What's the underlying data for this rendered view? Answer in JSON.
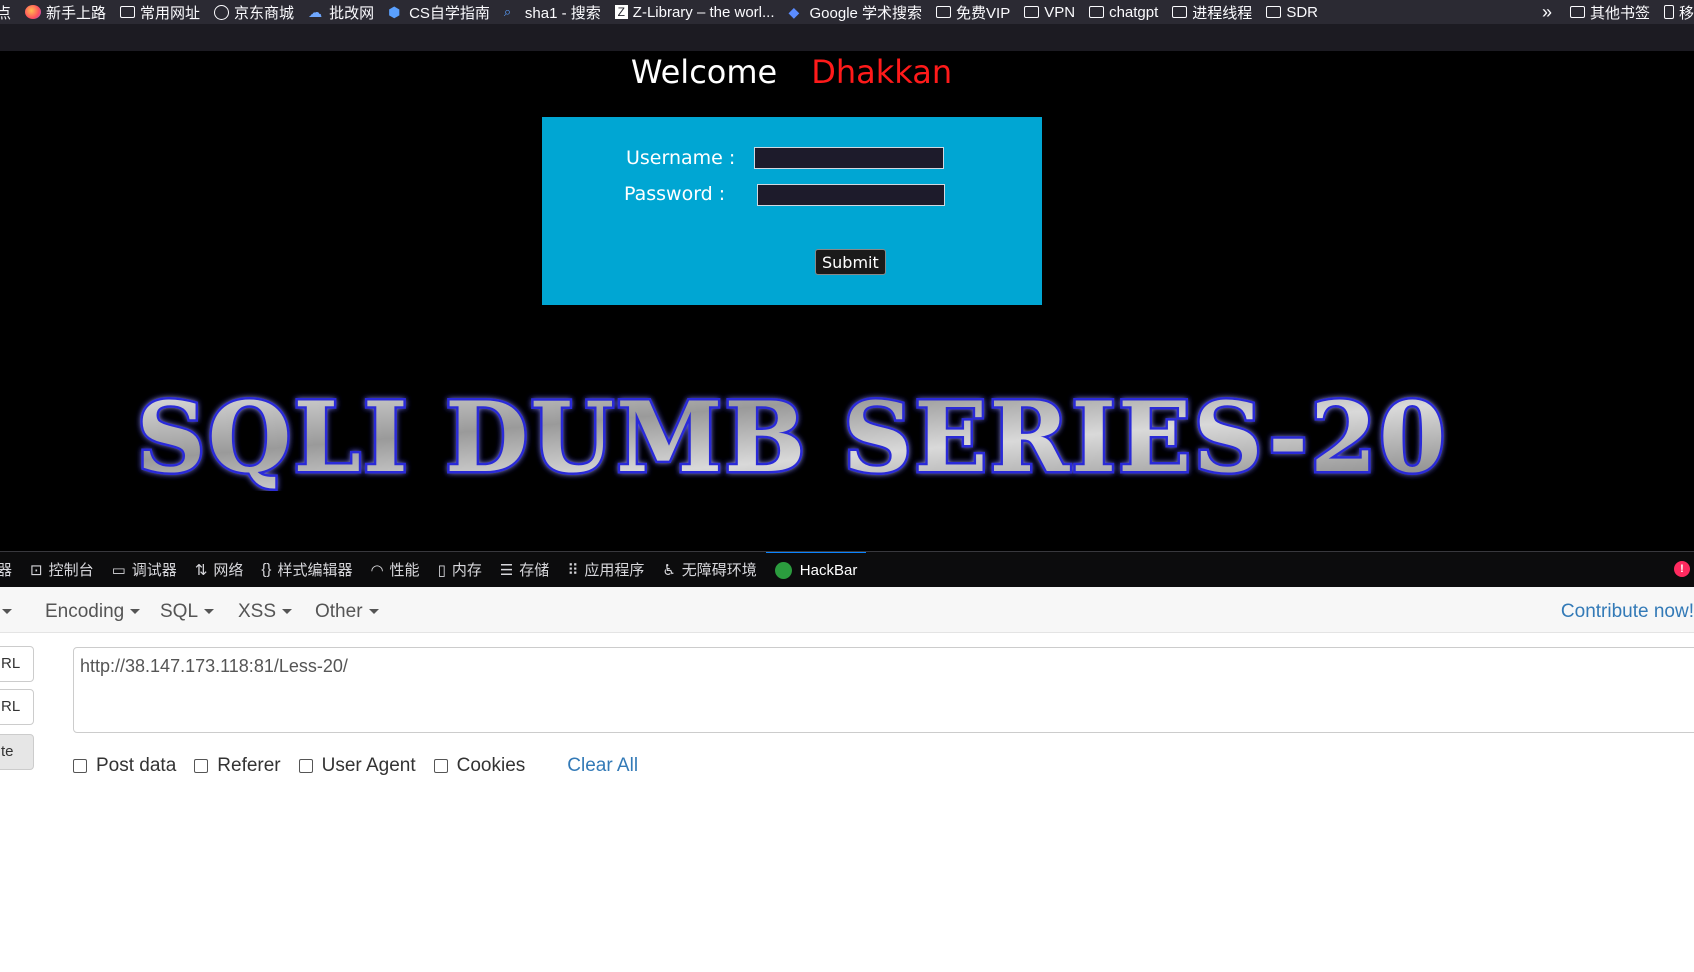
{
  "bookmarks": [
    {
      "label": "点",
      "icon": "bookmark-icon"
    },
    {
      "label": "新手上路",
      "icon": "firefox-icon"
    },
    {
      "label": "常用网址",
      "icon": "folder-icon"
    },
    {
      "label": "京东商城",
      "icon": "globe-icon"
    },
    {
      "label": "批改网",
      "icon": "cloud-icon"
    },
    {
      "label": "CS自学指南",
      "icon": "cube-icon"
    },
    {
      "label": "sha1 - 搜索",
      "icon": "search-icon"
    },
    {
      "label": "Z-Library – the worl...",
      "icon": "zlibrary-icon"
    },
    {
      "label": "Google 学术搜索",
      "icon": "google-scholar-icon"
    },
    {
      "label": "免费VIP",
      "icon": "folder-icon"
    },
    {
      "label": "VPN",
      "icon": "folder-icon"
    },
    {
      "label": "chatgpt",
      "icon": "folder-icon"
    },
    {
      "label": "进程线程",
      "icon": "folder-icon"
    },
    {
      "label": "SDR",
      "icon": "folder-icon"
    }
  ],
  "bookmarks_right": {
    "overflow": "»",
    "other": "其他书签",
    "mobile": "移"
  },
  "page": {
    "welcome": "Welcome",
    "user": "Dhakkan",
    "username_label": "Username :",
    "password_label": "Password :",
    "submit": "Submit",
    "banner": "SQLI DUMB SERIES-20"
  },
  "devtools": {
    "tabs": [
      {
        "label": "器",
        "icon": "inspector-icon"
      },
      {
        "label": "控制台",
        "icon": "console-icon"
      },
      {
        "label": "调试器",
        "icon": "debugger-icon"
      },
      {
        "label": "网络",
        "icon": "network-icon"
      },
      {
        "label": "样式编辑器",
        "icon": "style-editor-icon"
      },
      {
        "label": "性能",
        "icon": "performance-icon"
      },
      {
        "label": "内存",
        "icon": "memory-icon"
      },
      {
        "label": "存储",
        "icon": "storage-icon"
      },
      {
        "label": "应用程序",
        "icon": "application-icon"
      },
      {
        "label": "无障碍环境",
        "icon": "accessibility-icon"
      },
      {
        "label": "HackBar",
        "icon": "hackbar-icon",
        "active": true
      }
    ],
    "error_badge": "!"
  },
  "hackbar": {
    "menus": [
      "Encoding",
      "SQL",
      "XSS",
      "Other"
    ],
    "contribute": "Contribute now!",
    "side_buttons": [
      "RL",
      "RL",
      "te"
    ],
    "url": "http://38.147.173.118:81/Less-20/",
    "options": [
      "Post data",
      "Referer",
      "User Agent",
      "Cookies"
    ],
    "clear_all": "Clear All"
  },
  "colors": {
    "login_bg": "#00a6d3",
    "user_name": "#ff1a1a",
    "accent": "#0a84ff",
    "link": "#337ab7"
  }
}
